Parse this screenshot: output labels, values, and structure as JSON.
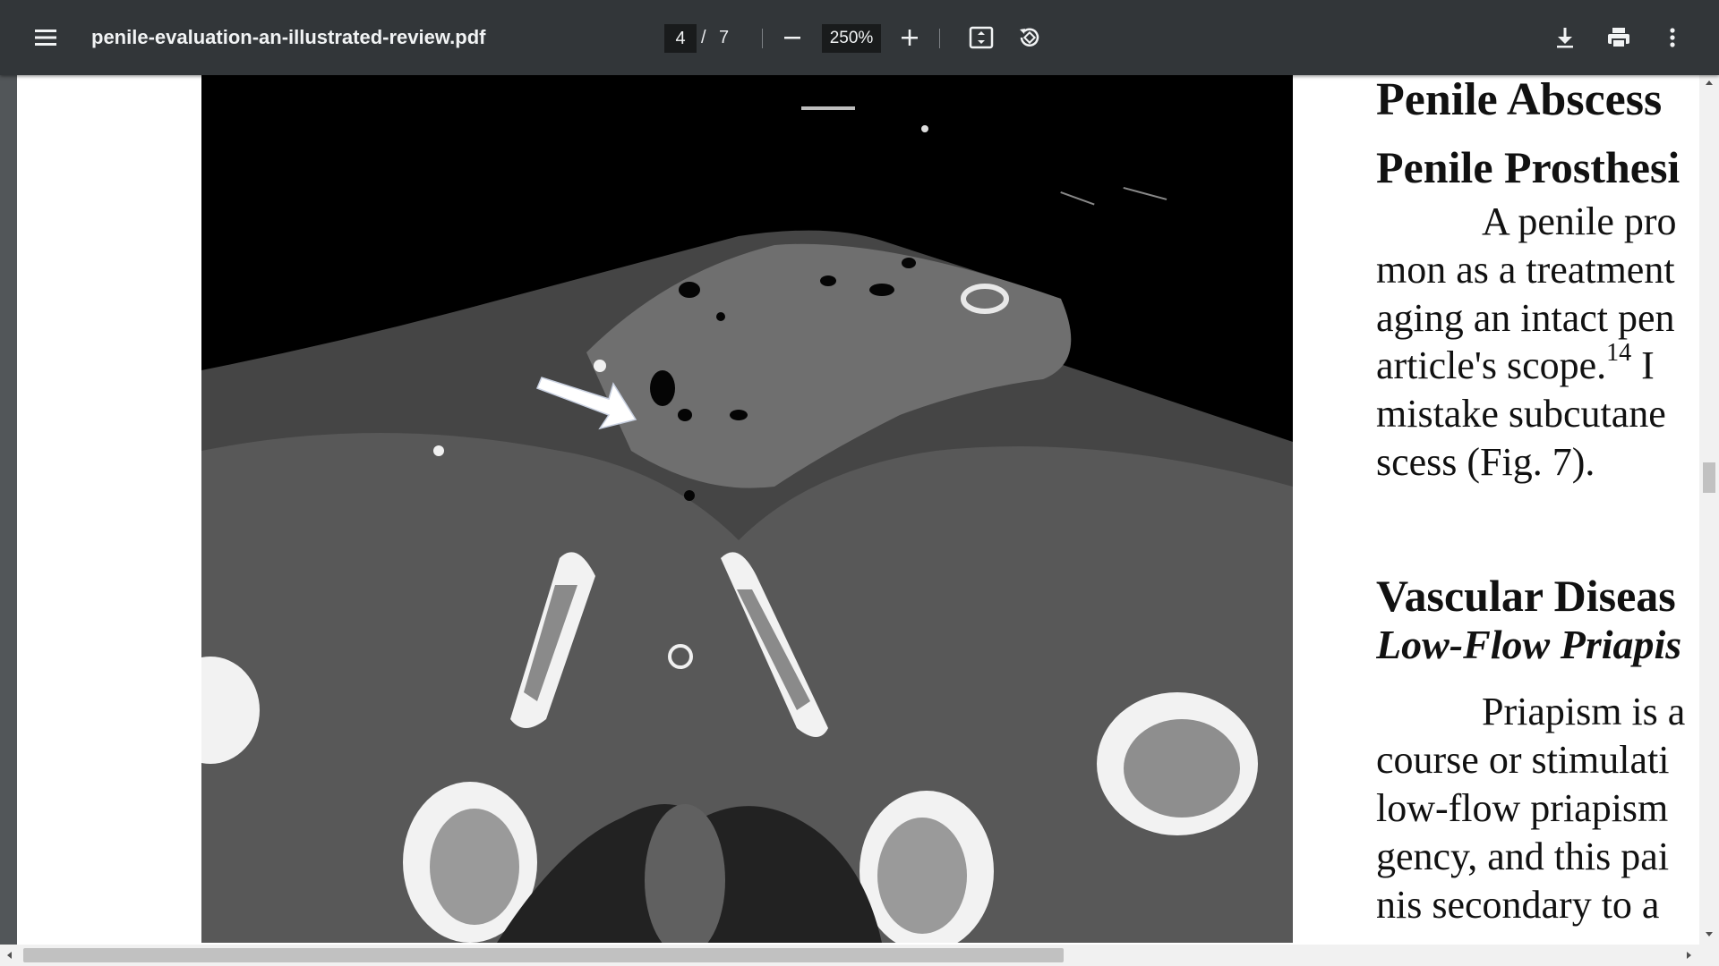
{
  "toolbar": {
    "menu_icon": "hamburger-menu-icon",
    "title": "penile-evaluation-an-illustrated-review.pdf",
    "page_current": "4",
    "page_separator": "/",
    "page_total": "7",
    "zoom": "250%",
    "icons": [
      "minus-icon",
      "plus-icon",
      "fit-to-page-icon",
      "rotate-icon",
      "download-icon",
      "print-icon",
      "more-vertical-icon"
    ]
  },
  "document": {
    "headings": {
      "abscess": "Penile Abscess",
      "prosthesis": "Penile Prosthesi",
      "vascular": "Vascular Diseas",
      "priapism": "Low-Flow Priapis"
    },
    "para1": {
      "line1": "A penile pro",
      "line2": "mon as a treatment",
      "line3": "aging an intact pen",
      "line4a": "article's scope.",
      "line4_sup": "14",
      "line4b": " I",
      "line5": "mistake subcutane",
      "line6": "scess (Fig. 7)."
    },
    "para2": {
      "line1": "Priapism is a",
      "line2": "course or stimulati",
      "line3": "low-flow priapism",
      "line4": "gency, and this pai",
      "line5": "nis secondary to a"
    }
  },
  "colors": {
    "toolbar_bg": "#323639",
    "viewer_bg": "#525659",
    "page_bg": "#ffffff",
    "scrollbar_thumb": "#c1c1c1"
  }
}
